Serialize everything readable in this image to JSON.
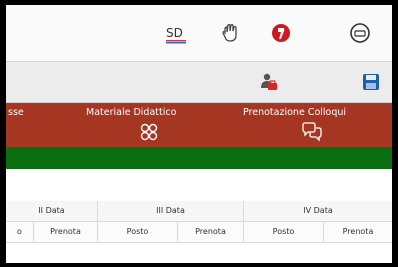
{
  "topbar": {
    "icons": [
      "sd-logo-icon",
      "hand-icon",
      "red-badge-icon",
      "exit-icon"
    ],
    "sd_text": "SD"
  },
  "toolbar": {
    "icons": [
      "users-icon",
      "save-icon"
    ]
  },
  "nav": {
    "partial_label": "sse",
    "items": [
      {
        "label": "Materiale Didattico",
        "icon": "materials-icon"
      },
      {
        "label": "Prenotazione Colloqui",
        "icon": "conversation-icon"
      }
    ]
  },
  "table": {
    "date_headers": [
      "II Data",
      "III Data",
      "IV Data"
    ],
    "subheaders": [
      "o",
      "Prenota",
      "Posto",
      "Prenota",
      "Posto",
      "Prenota"
    ]
  },
  "colors": {
    "nav_red": "#a53722",
    "green_bar": "#0a6d0f",
    "save_blue": "#1f5fa6"
  }
}
